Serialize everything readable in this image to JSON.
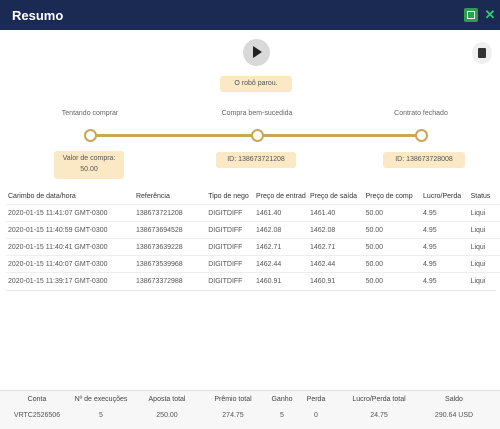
{
  "window": {
    "title": "Resumo"
  },
  "robot": {
    "status": "O robô parou."
  },
  "steps": [
    {
      "label": "Tentando comprar",
      "info": "Valor de compra:\n50.00"
    },
    {
      "label": "Compra bem-sucedida",
      "info": "ID: 138673721208"
    },
    {
      "label": "Contrato fechado",
      "info": "ID: 138673728008"
    }
  ],
  "table": {
    "headers": [
      "Carimbo de data/hora",
      "Referência",
      "Tipo de nego",
      "Preço de entrad",
      "Preço de saída",
      "Preço de comp",
      "Lucro/Perda",
      "Status"
    ],
    "rows": [
      [
        "2020-01-15 11:41:07 GMT-0300",
        "138673721208",
        "DIGITDIFF",
        "1461.40",
        "1461.40",
        "50.00",
        "4.95",
        "Liqui"
      ],
      [
        "2020-01-15 11:40:59 GMT-0300",
        "138673694528",
        "DIGITDIFF",
        "1462.08",
        "1462.08",
        "50.00",
        "4.95",
        "Liqui"
      ],
      [
        "2020-01-15 11:40:41 GMT-0300",
        "138673639228",
        "DIGITDIFF",
        "1462.71",
        "1462.71",
        "50.00",
        "4.95",
        "Liqui"
      ],
      [
        "2020-01-15 11:40:07 GMT-0300",
        "138673539968",
        "DIGITDIFF",
        "1462.44",
        "1462.44",
        "50.00",
        "4.95",
        "Liqui"
      ],
      [
        "2020-01-15 11:39:17 GMT-0300",
        "138673372988",
        "DIGITDIFF",
        "1460.91",
        "1460.91",
        "50.00",
        "4.95",
        "Liqui"
      ]
    ]
  },
  "summary": {
    "headers": [
      "Conta",
      "Nº de execuções",
      "Aposta total",
      "Prêmio total",
      "Ganho",
      "Perda",
      "Lucro/Perda total",
      "Saldo"
    ],
    "values": [
      "VRTC2526506",
      "5",
      "250.00",
      "274.75",
      "5",
      "0",
      "24.75",
      "290.64 USD"
    ]
  },
  "colors": {
    "titlebar": "#1a2a52",
    "accent": "#c9a75a",
    "profit": "#2e9e4b",
    "note_bg": "#fbe8c5"
  },
  "icons": {
    "play": "play-icon",
    "trash": "trash-icon",
    "save": "save-icon",
    "close": "close-icon"
  }
}
